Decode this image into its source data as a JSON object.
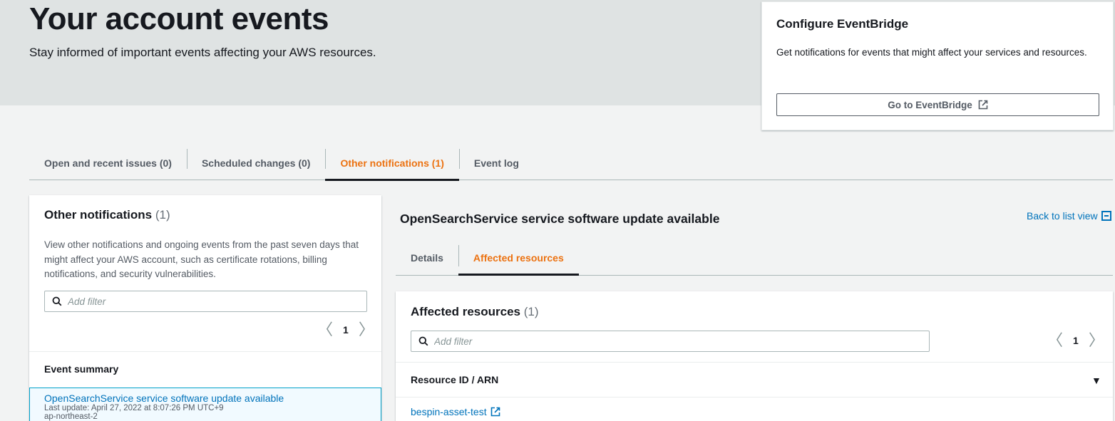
{
  "hero": {
    "title": "Your account events",
    "subtitle": "Stay informed of important events affecting your AWS resources."
  },
  "config": {
    "title": "Configure EventBridge",
    "description": "Get notifications for events that might affect your services and resources.",
    "button_label": "Go to EventBridge",
    "button_icon": "external-link-icon"
  },
  "tabs": [
    {
      "label": "Open and recent issues (0)",
      "active": false
    },
    {
      "label": "Scheduled changes (0)",
      "active": false
    },
    {
      "label": "Other notifications (1)",
      "active": true
    },
    {
      "label": "Event log",
      "active": false
    }
  ],
  "left_panel": {
    "title": "Other notifications",
    "count": "(1)",
    "description": "View other notifications and ongoing events from the past seven days that might affect your AWS account, such as certificate rotations, billing notifications, and security vulnerabilities.",
    "filter_placeholder": "Add filter",
    "page": "1",
    "column_header": "Event summary",
    "events": [
      {
        "title": "OpenSearchService service software update available",
        "last_update": "Last update: April 27, 2022 at 8:07:26 PM UTC+9",
        "region": "ap-northeast-2"
      }
    ]
  },
  "detail": {
    "title": "OpenSearchService service software update available",
    "back_label": "Back to list view",
    "tabs": [
      {
        "label": "Details",
        "active": false
      },
      {
        "label": "Affected resources",
        "active": true
      }
    ]
  },
  "affected": {
    "title": "Affected resources",
    "count": "(1)",
    "filter_placeholder": "Add filter",
    "page": "1",
    "column_header": "Resource ID / ARN",
    "sort_indicator": "▼",
    "resources": [
      "bespin-asset-test"
    ]
  },
  "colors": {
    "accent_orange": "#ec7211",
    "link_blue": "#0073bb",
    "hero_bg": "#dfe3e3",
    "page_bg": "#f2f3f3"
  },
  "glyphs": {
    "chevron_left": "〈",
    "chevron_right": "〉"
  }
}
